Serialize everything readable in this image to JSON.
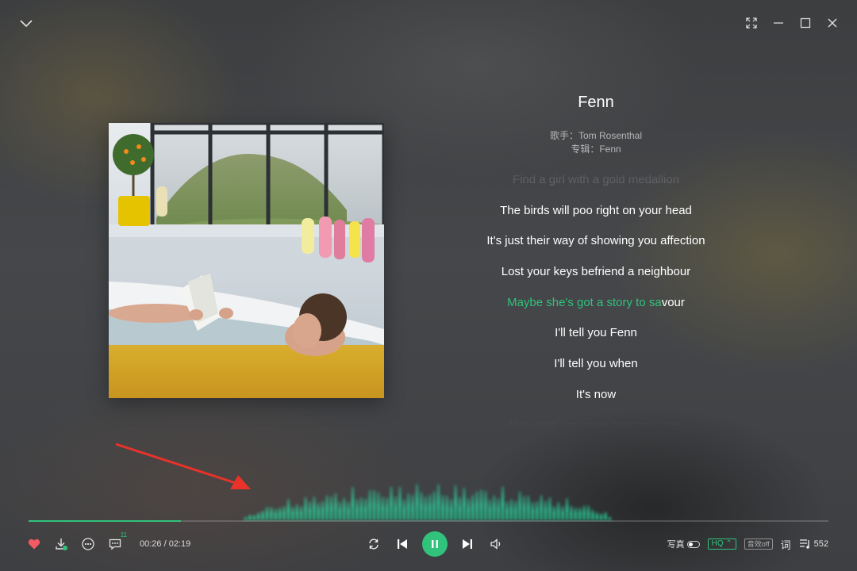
{
  "song": {
    "title": "Fenn",
    "singer_line": "歌手：Tom Rosenthal",
    "album_line": "专辑：Fenn"
  },
  "lyrics": {
    "lines": [
      {
        "text": "Find a girl with a gold medallion",
        "state": "faded"
      },
      {
        "text": "The birds will poo right on your head",
        "state": "normal"
      },
      {
        "text": "It's just their way of showing you affection",
        "state": "normal"
      },
      {
        "text": "Lost your keys befriend a neighbour",
        "state": "normal"
      },
      {
        "text": "I'll tell you Fenn",
        "state": "normal"
      },
      {
        "text": "I'll tell you when",
        "state": "normal"
      },
      {
        "text": "It's now",
        "state": "normal"
      },
      {
        "text": "Now now now now now now now",
        "state": "faded"
      }
    ],
    "current": {
      "sung": "Maybe she's got a story to sa",
      "unsung": "vour"
    }
  },
  "player": {
    "time_display": "00:26 / 02:19",
    "progress_fraction": 0.19,
    "comment_count": "11",
    "quality_label": "HQ",
    "effect_label": "音效off",
    "photo_label": "写真",
    "lyrics_button_label": "词",
    "playlist_count": "552"
  },
  "colors": {
    "accent": "#31c27c",
    "arrow": "#e8322a",
    "like": "#f25a64"
  },
  "icons": {
    "collapse": "chevron-down-icon",
    "fullscreen": "fullscreen-icon",
    "minimize": "minimize-icon",
    "maximize": "maximize-icon",
    "close": "close-icon",
    "like": "heart-icon",
    "download": "download-icon",
    "more": "more-icon",
    "comment": "comment-icon",
    "loop": "loop-icon",
    "prev": "previous-icon",
    "pause": "pause-icon",
    "next": "next-icon",
    "volume": "volume-icon",
    "lyrics": "lyrics-icon",
    "playlist": "playlist-icon"
  }
}
